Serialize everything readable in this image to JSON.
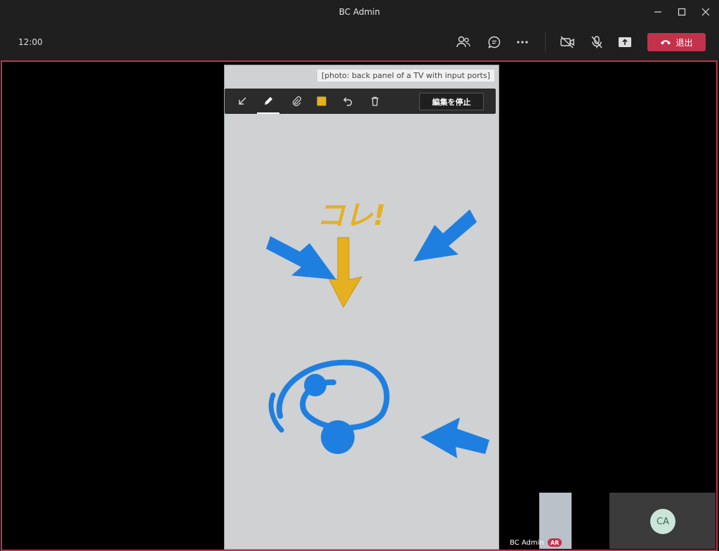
{
  "window": {
    "title": "BC Admin",
    "controls": [
      "minimize-icon",
      "maximize-icon",
      "close-icon"
    ]
  },
  "toolbar": {
    "time": "12:00",
    "icons": [
      "people-icon",
      "chat-icon",
      "more-icon",
      "camera-off-icon",
      "mic-off-icon",
      "share-screen-icon"
    ],
    "leave_label": "退出",
    "leave_color": "#c4314b"
  },
  "ink_toolbar": {
    "tools": [
      "collapse-icon",
      "pen-icon",
      "attach-icon",
      "color-swatch-icon",
      "undo-icon",
      "delete-icon"
    ],
    "active_tool": "pen-icon",
    "swatch_color": "#e6b021",
    "stop_label": "編集を停止"
  },
  "stage": {
    "image_label": "[photo: back panel of a TV with input ports]",
    "annotation_text": "コレ!",
    "annotation_colors": {
      "arrow_blue": "#1f7fe0",
      "arrow_yellow": "#e6b021"
    },
    "accent_border": "#c4314b"
  },
  "participants": {
    "remote_name": "BC Admin",
    "remote_badge": "AR",
    "self_initials": "CA"
  }
}
